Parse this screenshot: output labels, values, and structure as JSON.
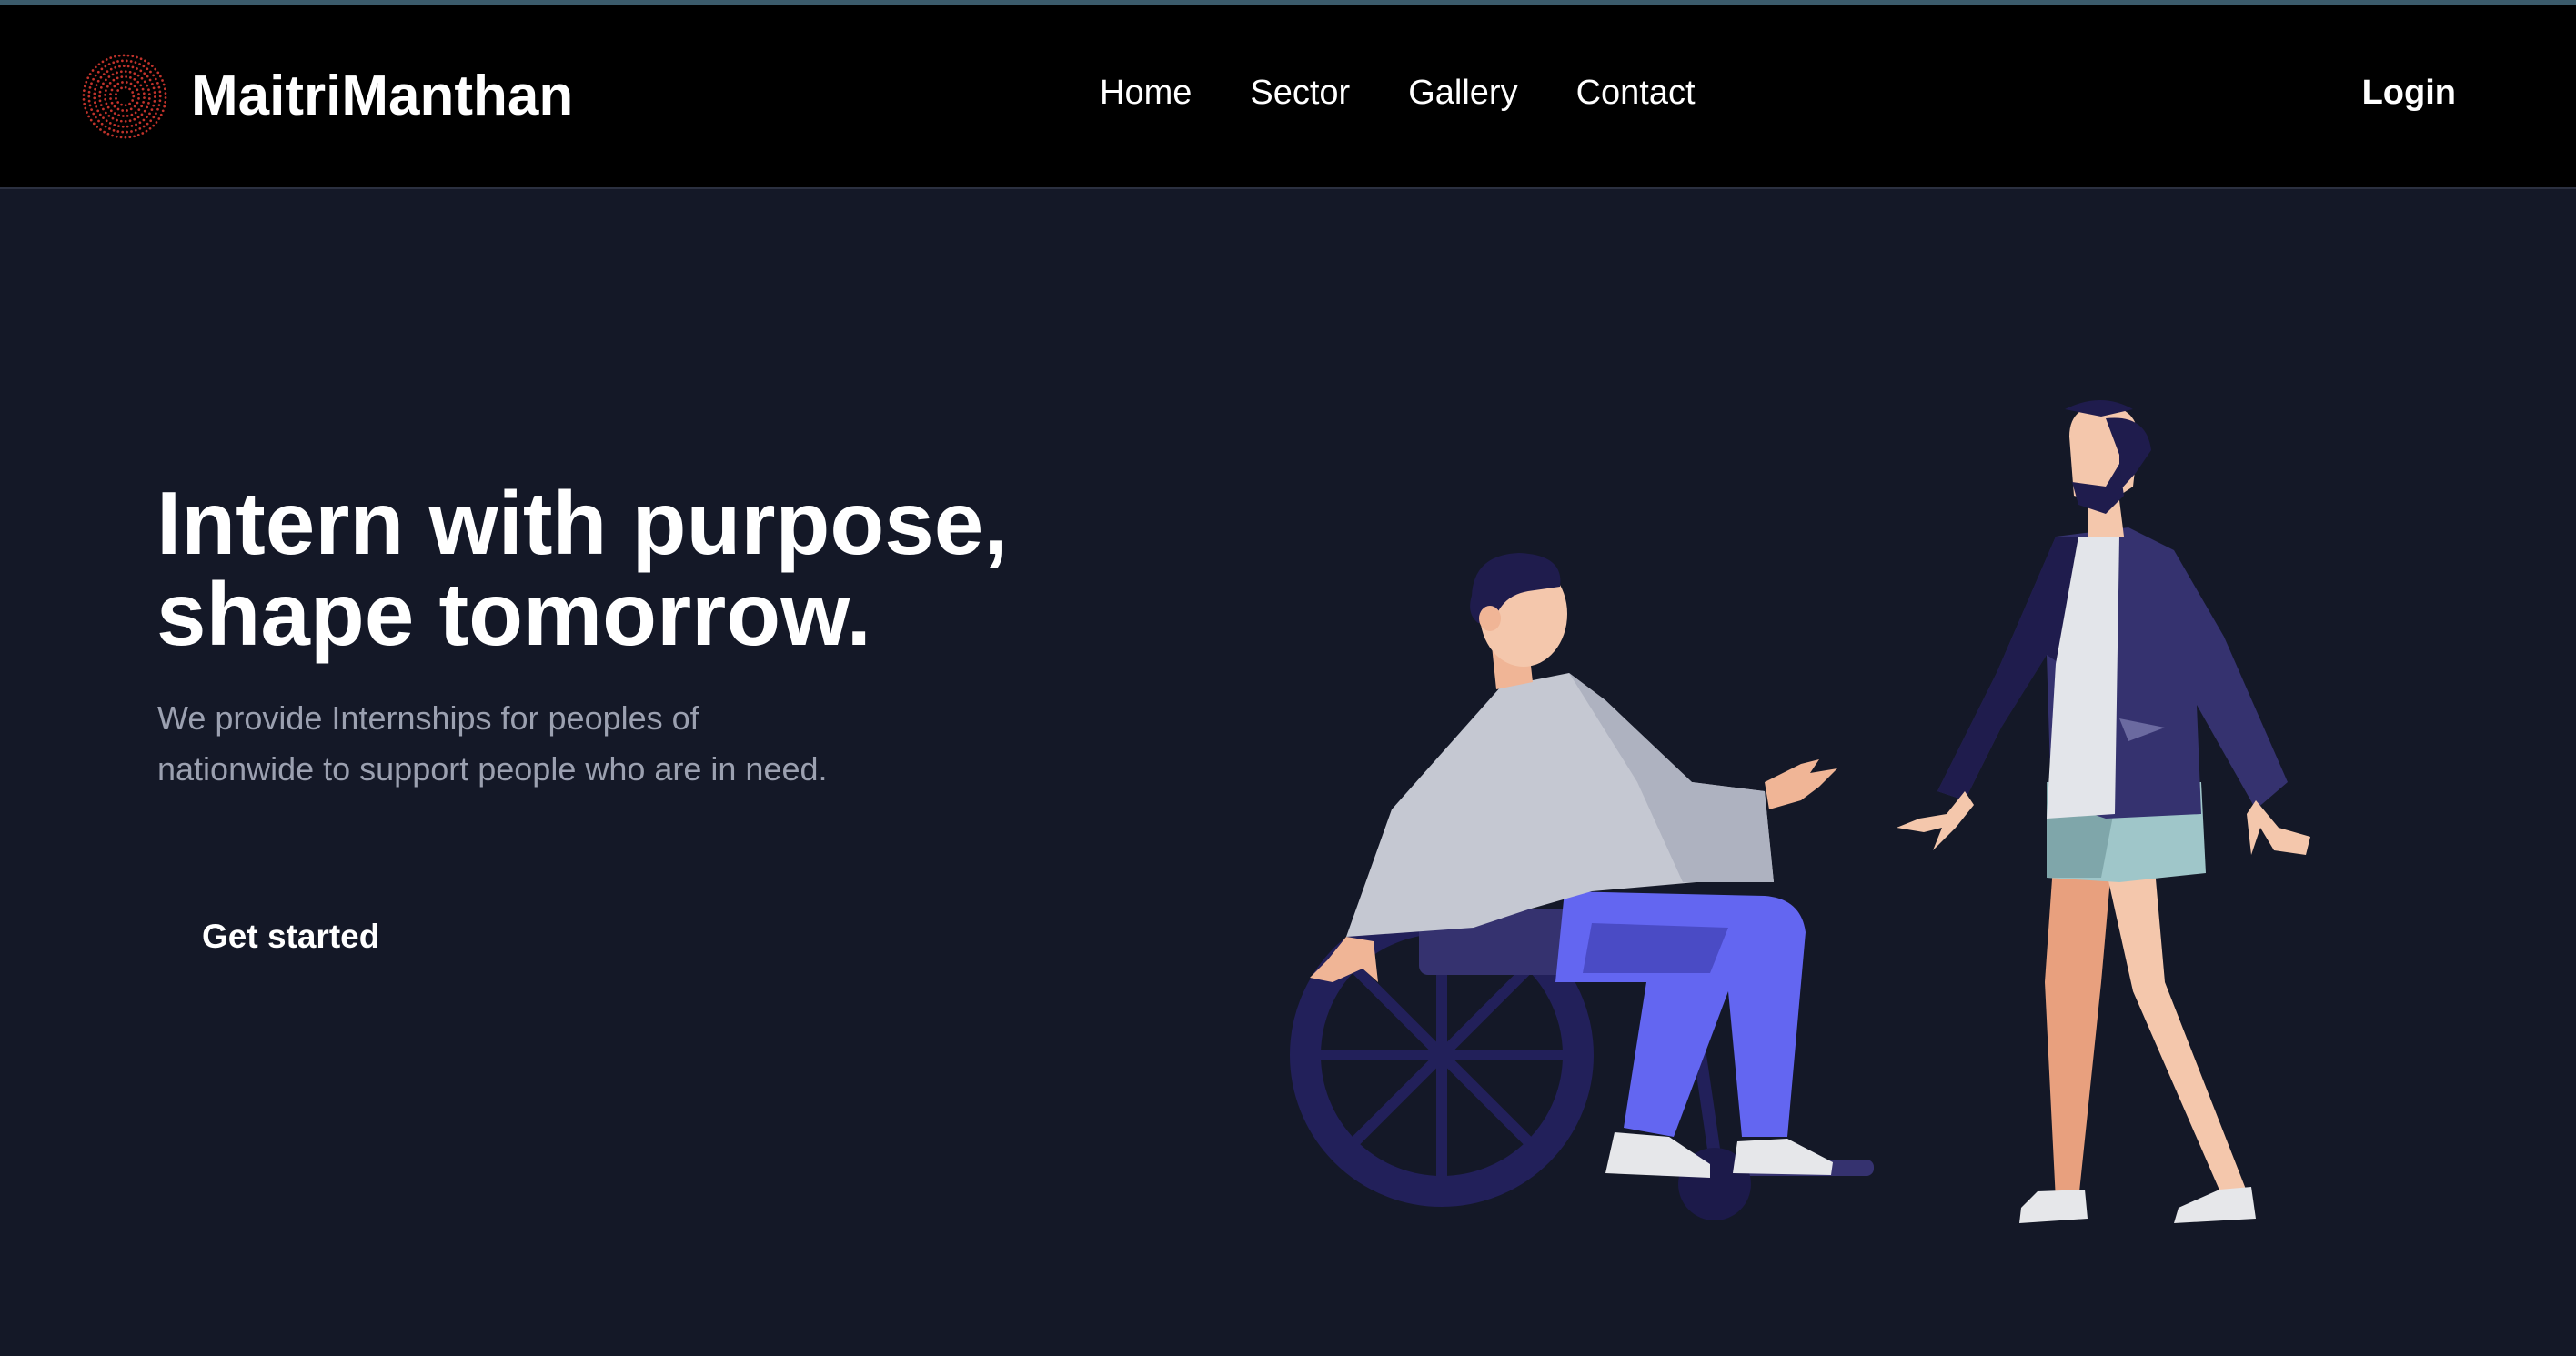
{
  "brand": {
    "name": "MaitriManthan",
    "logo_icon": "radial-dots-logo",
    "logo_color": "#c0332b"
  },
  "nav": {
    "items": [
      {
        "label": "Home"
      },
      {
        "label": "Sector"
      },
      {
        "label": "Gallery"
      },
      {
        "label": "Contact"
      }
    ],
    "login_label": "Login"
  },
  "hero": {
    "title_line1": "Intern with purpose,",
    "title_line2": "shape tomorrow.",
    "subtitle_line1": "We provide Internships for peoples of",
    "subtitle_line2": "nationwide to support people who are in need.",
    "cta_label": "Get started"
  },
  "colors": {
    "background": "#141827",
    "navbar": "#000000",
    "text": "#ffffff",
    "muted_text": "#9ba0b0"
  }
}
